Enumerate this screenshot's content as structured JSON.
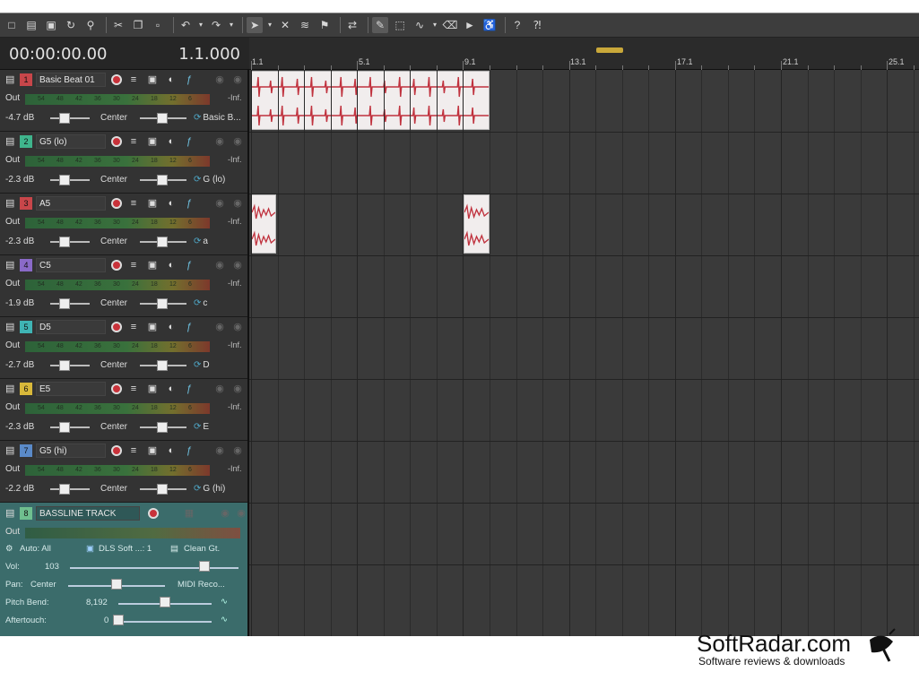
{
  "toolbar": {
    "icons": [
      "new-icon",
      "open-icon",
      "save-icon",
      "loop-icon",
      "zoom-icon",
      "cut-icon",
      "copy-icon",
      "paste-icon",
      "undo-icon",
      "redo-icon",
      "pointer-icon",
      "crossfade-icon",
      "snap-icon",
      "marker-icon",
      "autoscroll-icon",
      "pencil-icon",
      "select-icon",
      "envelope-icon",
      "erase-icon",
      "scrub-icon",
      "split-icon",
      "help-icon",
      "whats-this-icon"
    ]
  },
  "transport": {
    "timecode": "00:00:00.00",
    "measure": "1.1.000"
  },
  "ruler": {
    "marks": [
      "1.1",
      "5.1",
      "9.1",
      "13.1",
      "17.1",
      "21.1",
      "25.1"
    ]
  },
  "tracks": [
    {
      "num": "1",
      "name": "Basic Beat 01",
      "color": "#c8464a",
      "vol": "-4.7 dB",
      "pan": "Center",
      "out": "Basic B...",
      "meter": [
        "54",
        "48",
        "42",
        "36",
        "30",
        "24",
        "18",
        "12",
        "6"
      ],
      "inf": "-Inf."
    },
    {
      "num": "2",
      "name": "G5 (lo)",
      "color": "#3fb48c",
      "vol": "-2.3 dB",
      "pan": "Center",
      "out": "G (lo)",
      "meter": [
        "54",
        "48",
        "42",
        "36",
        "30",
        "24",
        "18",
        "12",
        "6"
      ],
      "inf": "-Inf."
    },
    {
      "num": "3",
      "name": "A5",
      "color": "#c8464a",
      "vol": "-2.3 dB",
      "pan": "Center",
      "out": "a",
      "meter": [
        "54",
        "48",
        "42",
        "36",
        "30",
        "24",
        "18",
        "12",
        "6"
      ],
      "inf": "-Inf."
    },
    {
      "num": "4",
      "name": "C5",
      "color": "#8a6ac8",
      "vol": "-1.9 dB",
      "pan": "Center",
      "out": "c",
      "meter": [
        "54",
        "48",
        "42",
        "36",
        "30",
        "24",
        "18",
        "12",
        "6"
      ],
      "inf": "-Inf."
    },
    {
      "num": "5",
      "name": "D5",
      "color": "#3fb4b4",
      "vol": "-2.7 dB",
      "pan": "Center",
      "out": "D",
      "meter": [
        "54",
        "48",
        "42",
        "36",
        "30",
        "24",
        "18",
        "12",
        "6"
      ],
      "inf": "-Inf."
    },
    {
      "num": "6",
      "name": "E5",
      "color": "#d8b83a",
      "vol": "-2.3 dB",
      "pan": "Center",
      "out": "E",
      "meter": [
        "54",
        "48",
        "42",
        "36",
        "30",
        "24",
        "18",
        "12",
        "6"
      ],
      "inf": "-Inf."
    },
    {
      "num": "7",
      "name": "G5 (hi)",
      "color": "#5a8ac8",
      "vol": "-2.2 dB",
      "pan": "Center",
      "out": "G (hi)",
      "meter": [
        "54",
        "48",
        "42",
        "36",
        "30",
        "24",
        "18",
        "12",
        "6"
      ],
      "inf": "-Inf."
    }
  ],
  "midi": {
    "num": "8",
    "name": "BASSLINE TRACK",
    "out": "Out",
    "auto": "Auto: All",
    "synth": "DLS Soft ...: 1",
    "instrument": "Clean Gt.",
    "vol_label": "Vol:",
    "vol_value": "103",
    "pan_label": "Pan:",
    "pan_value": "Center",
    "midi_out": "MIDI Reco...",
    "pitch_label": "Pitch Bend:",
    "pitch_value": "8,192",
    "after_label": "Aftertouch:",
    "after_value": "0"
  },
  "brand": {
    "name": "SoftRadar.com",
    "tagline": "Software reviews & downloads"
  }
}
